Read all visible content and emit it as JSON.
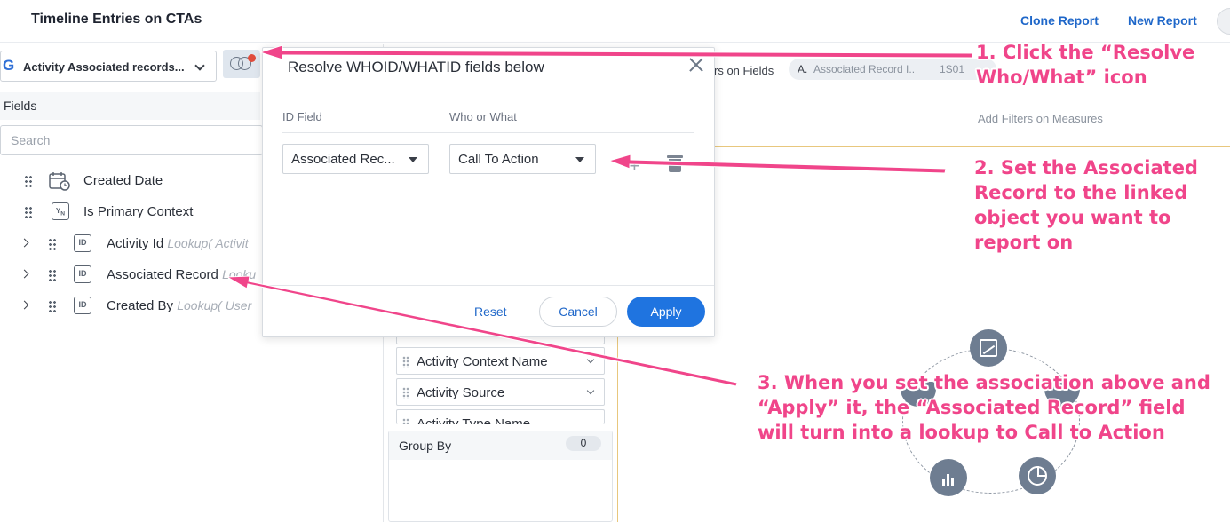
{
  "header": {
    "title": "Timeline Entries on CTAs",
    "clone_report": "Clone Report",
    "new_report": "New Report"
  },
  "left": {
    "object_select": "Activity Associated records...",
    "fields_label": "Fields",
    "search_placeholder": "Search",
    "fields": [
      {
        "icon": "calendar-icon",
        "name": "Created Date",
        "lookup": ""
      },
      {
        "icon": "yn-icon",
        "name": "Is Primary Context",
        "lookup": ""
      },
      {
        "icon": "id-icon",
        "name": "Activity Id",
        "lookup": "Lookup( Activit"
      },
      {
        "icon": "id-icon",
        "name": "Associated Record",
        "lookup": "Looku"
      },
      {
        "icon": "id-icon",
        "name": "Created By",
        "lookup": "Lookup( User"
      }
    ]
  },
  "middle": {
    "pills": [
      "Activity Context Name",
      "Activity Source",
      "Activity Type Name"
    ],
    "group_by_label": "Group By",
    "group_by_count": "0"
  },
  "right": {
    "filters_on_fields": "rs on Fields",
    "filter_pill_prefix": "A.",
    "filter_pill_text": "Associated Record  I..",
    "filter_pill_value": "1S01",
    "filters_on_measures": "Add Filters on Measures"
  },
  "modal": {
    "title": "Resolve WHOID/WHATID fields below",
    "col_id_field": "ID Field",
    "col_who_what": "Who or What",
    "id_field_value": "Associated Rec...",
    "who_what_value": "Call To Action",
    "reset": "Reset",
    "cancel": "Cancel",
    "apply": "Apply"
  },
  "annotations": {
    "step1": [
      "1. Click the “Resolve",
      "Who/What” icon"
    ],
    "step2": [
      "2. Set the Associated",
      "Record to the linked",
      "object you want to",
      "report on"
    ],
    "step3": [
      "3. When you set the association above and",
      "“Apply” it, the “Associated Record” field",
      "will turn into a lookup to Call to Action"
    ]
  },
  "colors": {
    "accent": "#1f74e0",
    "annotation": "#f0458a",
    "notification_dot": "#e04c3c"
  }
}
